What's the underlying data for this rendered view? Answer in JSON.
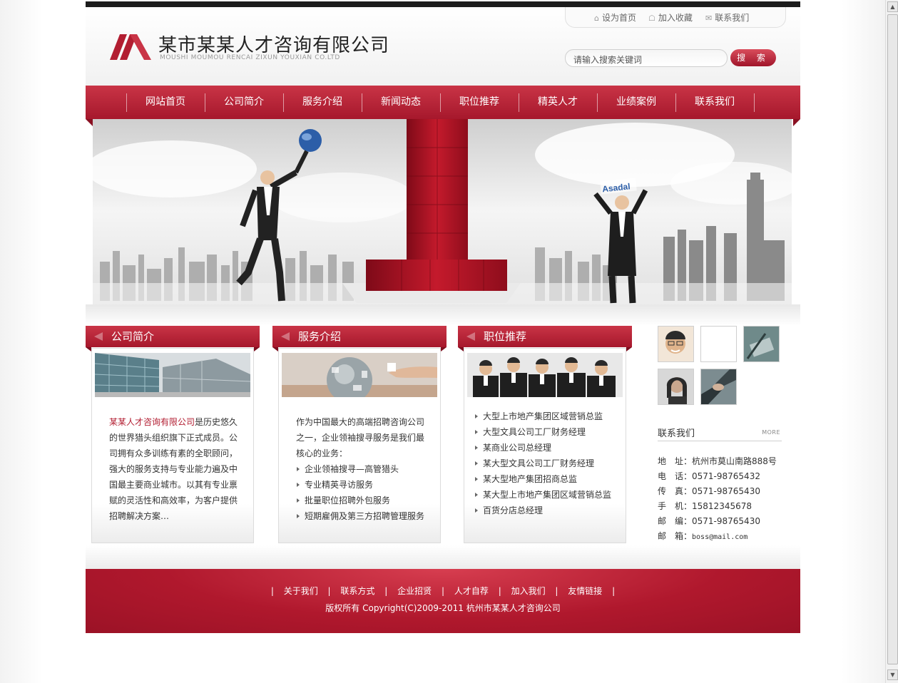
{
  "header": {
    "company_cn": "某市某某人才咨询有限公司",
    "company_en": "MOUSHI MOUMOU RENCAI ZIXUN YOUXIAN CO.LTD",
    "toplinks": [
      "设为首页",
      "加入收藏",
      "联系我们"
    ],
    "search_placeholder": "请输入搜索关键词",
    "search_button": "搜 索"
  },
  "nav": [
    "网站首页",
    "公司简介",
    "服务介绍",
    "新闻动态",
    "职位推荐",
    "精英人才",
    "业绩案例",
    "联系我们"
  ],
  "banner": {
    "sign_text": "Asadal"
  },
  "about": {
    "title": "公司简介",
    "company_link": "某某人才咨询有限公司",
    "text": "是历史悠久的世界猎头组织旗下正式成员。公司拥有众多训练有素的全职顾问，强大的服务支持与专业能力遍及中国最主要商业城市。以其有专业禀赋的灵活性和高效率，为客户提供招聘解决方案…"
  },
  "services": {
    "title": "服务介绍",
    "intro": "作为中国最大的高端招聘咨询公司之一，企业领袖搜寻服务是我们最核心的业务：",
    "items": [
      "企业领袖搜寻—高管猎头",
      "专业精英寻访服务",
      "批量职位招聘外包服务",
      "短期雇佣及第三方招聘管理服务"
    ]
  },
  "jobs": {
    "title": "职位推荐",
    "items": [
      "大型上市地产集团区域营销总监",
      "大型文具公司工厂财务经理",
      "某商业公司总经理",
      "某大型文具公司工厂财务经理",
      "某大型地产集团招商总监",
      "某大型上市地产集团区域营销总监",
      "百货分店总经理"
    ]
  },
  "contact": {
    "title": "联系我们",
    "more": "MORE",
    "rows": [
      {
        "label": "地　址：",
        "value": "杭州市莫山南路888号",
        "mono": false
      },
      {
        "label": "电　话：",
        "value": "0571-98765432",
        "mono": false
      },
      {
        "label": "传　真：",
        "value": "0571-98765430",
        "mono": false
      },
      {
        "label": "手　机：",
        "value": "15812345678",
        "mono": false
      },
      {
        "label": "邮　编：",
        "value": "0571-98765430",
        "mono": false
      },
      {
        "label": "邮　箱：",
        "value": "boss@mail.com",
        "mono": true
      }
    ]
  },
  "footer": {
    "links": [
      "关于我们",
      "联系方式",
      "企业招贤",
      "人才自荐",
      "加入我们",
      "友情链接"
    ],
    "separator": "|",
    "copyright": "版权所有  Copyright(C)2009-2011 杭州市某某人才咨询公司"
  },
  "colors": {
    "brand_red": "#b21d31",
    "dark_bar": "#1c1c1c"
  }
}
